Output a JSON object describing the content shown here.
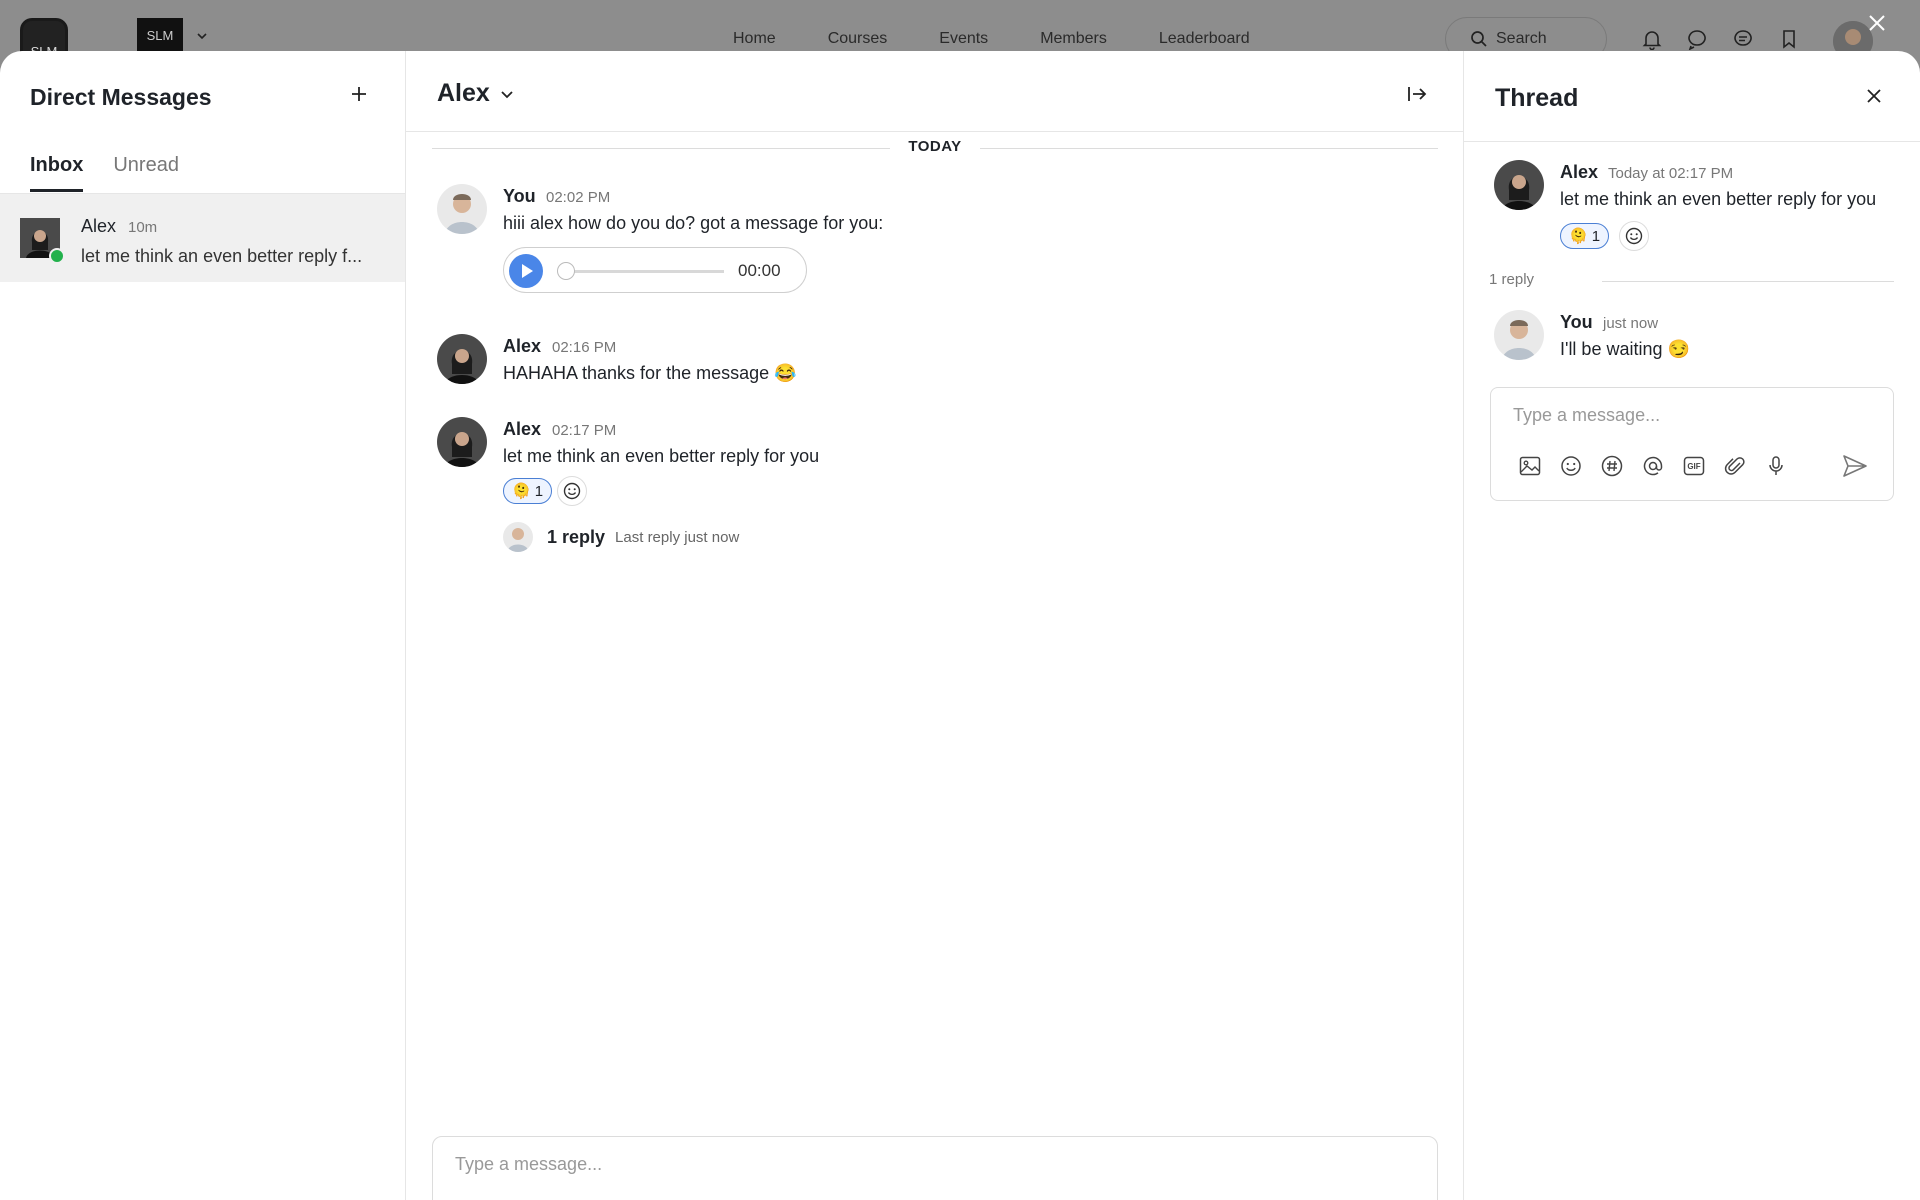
{
  "topnav": {
    "logo_text": "SLM",
    "brand_text": "SLM",
    "links": [
      "Home",
      "Courses",
      "Events",
      "Members",
      "Leaderboard"
    ],
    "search_label": "Search"
  },
  "sidebar": {
    "title": "Direct Messages",
    "tabs": [
      {
        "label": "Inbox",
        "active": true
      },
      {
        "label": "Unread",
        "active": false
      }
    ],
    "conversations": [
      {
        "name": "Alex",
        "time": "10m",
        "preview": "let me think an even better reply f...",
        "online": true
      }
    ]
  },
  "chat": {
    "title": "Alex",
    "date_divider": "TODAY",
    "messages": [
      {
        "author": "You",
        "time": "02:02 PM",
        "text": "hiii alex how do you do? got a message for you:",
        "audio_time": "00:00"
      },
      {
        "author": "Alex",
        "time": "02:16 PM",
        "text": "HAHAHA thanks for the message 😂"
      },
      {
        "author": "Alex",
        "time": "02:17 PM",
        "text": "let me think an even better reply for you",
        "reaction": {
          "emoji": "🫠",
          "count": "1"
        },
        "reply_count": "1 reply",
        "last_reply": "Last reply just now"
      }
    ],
    "composer_placeholder": "Type a message..."
  },
  "thread": {
    "title": "Thread",
    "root": {
      "author": "Alex",
      "time": "Today at 02:17 PM",
      "text": "let me think an even better reply for you",
      "reaction": {
        "emoji": "🫠",
        "count": "1"
      }
    },
    "reply_divider": "1 reply",
    "reply": {
      "author": "You",
      "time": "just now",
      "text": "I'll be waiting 😏"
    },
    "composer_placeholder": "Type a message...",
    "tools": [
      "image-icon",
      "emoji-icon",
      "hashtag-icon",
      "mention-icon",
      "gif-icon",
      "attach-icon",
      "mic-icon"
    ],
    "gif_label": "GIF"
  },
  "colors": {
    "accent": "#4a86e8",
    "online": "#22b14c",
    "reaction_border": "#4a7fd4"
  }
}
